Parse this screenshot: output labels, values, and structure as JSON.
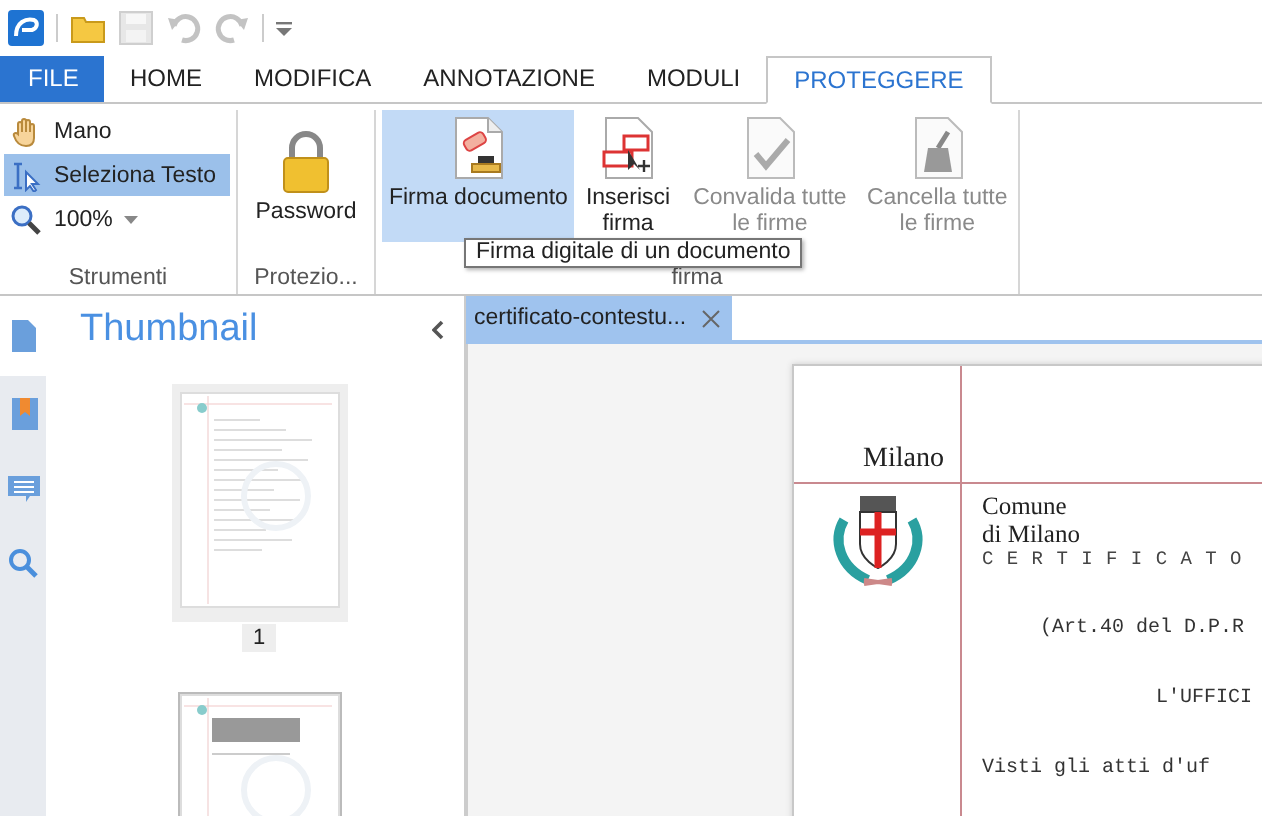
{
  "quick_access": [
    {
      "kind": "open",
      "disabled": false
    },
    {
      "kind": "save",
      "disabled": true
    },
    {
      "kind": "undo",
      "disabled": true
    },
    {
      "kind": "redo",
      "disabled": true
    }
  ],
  "tabs": [
    {
      "label": "FILE",
      "kind": "file",
      "selected": false
    },
    {
      "label": "HOME",
      "kind": "tab",
      "selected": false
    },
    {
      "label": "MODIFICA",
      "kind": "tab",
      "selected": false
    },
    {
      "label": "ANNOTAZIONE",
      "kind": "tab",
      "selected": false
    },
    {
      "label": "MODULI",
      "kind": "tab",
      "selected": false
    },
    {
      "label": "PROTEGGERE",
      "kind": "tab",
      "selected": true
    }
  ],
  "ribbon": {
    "groups": [
      {
        "label": "Strumenti",
        "kind": "small",
        "items": [
          {
            "label": "Mano",
            "kind": "hand",
            "selected": false,
            "dropdown": false
          },
          {
            "label": "Seleziona Testo",
            "kind": "select",
            "selected": true,
            "dropdown": false
          },
          {
            "label": "100%",
            "kind": "zoom",
            "selected": false,
            "dropdown": true
          }
        ]
      },
      {
        "label": "Protezio...",
        "kind": "large",
        "items": [
          {
            "label": "Password",
            "kind": "lock",
            "hover": false,
            "disabled": false
          }
        ]
      },
      {
        "label": "firma",
        "kind": "large",
        "items": [
          {
            "label": "Firma documento",
            "kind": "sign",
            "hover": true,
            "disabled": false
          },
          {
            "label": "Inserisci firma",
            "kind": "insert",
            "hover": false,
            "disabled": false
          },
          {
            "label": "Convalida tutte le firme",
            "kind": "validate",
            "hover": false,
            "disabled": true
          },
          {
            "label": "Cancella tutte le firme",
            "kind": "clear",
            "hover": false,
            "disabled": true
          }
        ]
      }
    ]
  },
  "tooltip": "Firma digitale di un documento",
  "side_strip": [
    {
      "kind": "page",
      "selected": true
    },
    {
      "kind": "bookmark",
      "selected": false
    },
    {
      "kind": "comment",
      "selected": false
    },
    {
      "kind": "search",
      "selected": false
    }
  ],
  "thumbnail_panel": {
    "title": "Thumbnail",
    "pages": [
      {
        "label": "1",
        "selected": true
      },
      {
        "selected": false
      }
    ]
  },
  "document_tab": {
    "title": "certificato-contestu..."
  },
  "document": {
    "header": "Milano",
    "lines": [
      {
        "kind": "serif",
        "text": "Comune"
      },
      {
        "kind": "serif",
        "text": "di Milano"
      },
      {
        "kind": "spaced",
        "text": "C E R T I F I C A T O"
      },
      {
        "kind": "indented",
        "text": "(Art.40 del D.P.R"
      },
      {
        "kind": "centered",
        "text": "L'UFFICI"
      },
      {
        "kind": "body",
        "text": "Visti gli atti d'uf"
      }
    ]
  }
}
